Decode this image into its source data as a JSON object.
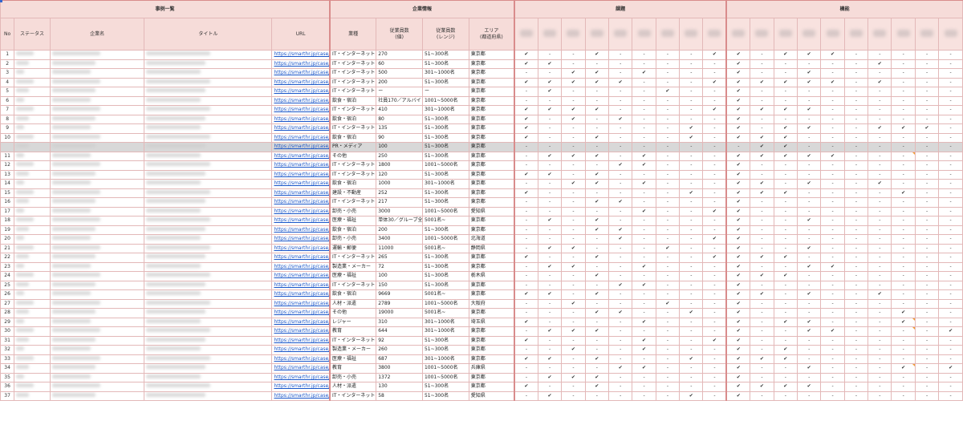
{
  "groups": {
    "cases": "事例一覧",
    "company": "企業情報",
    "issues": "課題",
    "features": "機能"
  },
  "columns": {
    "no": "No",
    "status": "ステータス",
    "company_name": "企業名",
    "title": "タイトル",
    "url": "URL",
    "industry": "業種",
    "employees": "従業員数\n(値)",
    "employees_range": "従業員数\n(レンジ)",
    "area": "エリア\n(都道府県)"
  },
  "rows": [
    {
      "no": "1",
      "url": "https://smarthr.jp/case/25",
      "industry": "IT・インターネット",
      "emp": "270",
      "range": "51~300名",
      "area": "東京都",
      "m": "✔,-,-,✔,-,-,-,-,✔,✔,-,✔,✔,✔,-,-,-,-,-"
    },
    {
      "no": "2",
      "url": "https://smarthr.jp/case/3",
      "industry": "IT・インターネット",
      "emp": "60",
      "range": "51~300名",
      "area": "東京都",
      "m": "✔,✔,-,-,-,-,-,-,-,✔,-,-,-,-,-,✔,-,-,-"
    },
    {
      "no": "3",
      "url": "https://smarthr.jp/case/30",
      "industry": "IT・インターネット",
      "emp": "500",
      "range": "301~1000名",
      "area": "東京都",
      "m": "-,-,✔,✔,-,✔,-,-,-,✔,-,-,✔,-,-,-,-,-,-"
    },
    {
      "no": "4",
      "url": "https://smarthr.jp/case/4",
      "industry": "IT・インターネット",
      "emp": "200",
      "range": "51~300名",
      "area": "東京都",
      "m": "✔,✔,✔,✔,✔,-,-,-,✔,✔,✔,✔,✔,✔,-,✔,-,-,-"
    },
    {
      "no": "5",
      "url": "https://smarthr.jp/case/5",
      "industry": "IT・インターネット",
      "emp": "ー",
      "range": "ー",
      "area": "東京都",
      "m": "-,✔,-,-,-,-,✔,-,-,✔,-,-,-,-,-,-,-,-,-"
    },
    {
      "no": "6",
      "url": "https://smarthr.jp/case/7",
      "industry": "飲食・宿泊",
      "emp": "社員170／アルバイ",
      "range": "1001~5000名",
      "area": "東京都",
      "m": "-,-,-,-,-,-,-,-,-,✔,-,-,-,-,-,-,-,-,-"
    },
    {
      "no": "7",
      "url": "https://smarthr.jp/case/10",
      "industry": "IT・インターネット",
      "emp": "410",
      "range": "301~1000名",
      "area": "東京都",
      "m": "✔,✔,✔,✔,-,-,-,-,✔,✔,✔,✔,✔,-,-,-,-,-,-"
    },
    {
      "no": "8",
      "url": "https://smarthr.jp/case/10",
      "industry": "飲食・宿泊",
      "emp": "80",
      "range": "51~300名",
      "area": "東京都",
      "m": "✔,-,✔,-,✔,-,-,-,-,✔,-,-,-,-,-,-,-,-,-"
    },
    {
      "no": "9",
      "url": "https://smarthr.jp/case/10",
      "industry": "IT・インターネット",
      "emp": "135",
      "range": "51~300名",
      "area": "東京都",
      "m": "✔,-,-,-,-,-,-,✔,-,✔,-,✔,✔,-,-,✔,✔,✔,-"
    },
    {
      "no": "10",
      "url": "https://smarthr.jp/case/10",
      "industry": "飲食・宿泊",
      "emp": "90",
      "range": "51~300名",
      "area": "東京都",
      "m": "✔,-,-,✔,-,-,-,✔,-,✔,✔,✔,-,-,-,-,-,-,-"
    },
    {
      "no": "",
      "url": "https://smarthr.jp/case/11",
      "industry": "PR・メディア",
      "emp": "100",
      "range": "51~300名",
      "area": "東京都",
      "m": "-,-,-,-,-,-,-,-,-,-,✔,✔,-,-,-,-,-,-,-",
      "hl": true
    },
    {
      "no": "11",
      "url": "https://smarthr.jp/case/se",
      "industry": "その他",
      "emp": "250",
      "range": "51~300名",
      "area": "東京都",
      "m": "-,✔,✔,✔,-,✔,-,-,-,✔,✔,✔,✔,✔,-,-,-,-,-"
    },
    {
      "no": "12",
      "url": "https://smarthr.jp/case/dr",
      "industry": "IT・インターネット",
      "emp": "1800",
      "range": "1001~5000名",
      "area": "東京都",
      "m": "-,-,-,-,✔,✔,-,-,-,✔,-,-,-,-,-,-,-,-,-"
    },
    {
      "no": "13",
      "url": "https://smarthr.jp/case/se",
      "industry": "IT・インターネット",
      "emp": "120",
      "range": "51~300名",
      "area": "東京都",
      "m": "✔,✔,-,✔,-,-,-,-,-,✔,-,-,-,-,-,-,-,-,-"
    },
    {
      "no": "14",
      "url": "https://smarthr.jp/case/se",
      "industry": "飲食・宿泊",
      "emp": "1000",
      "range": "301~1000名",
      "area": "東京都",
      "m": "-,-,✔,✔,-,✔,-,-,-,✔,✔,-,✔,-,-,✔,-,-,-"
    },
    {
      "no": "15",
      "url": "https://smarthr.jp/case/ka",
      "industry": "建設・不動産",
      "emp": "252",
      "range": "51~300名",
      "area": "東京都",
      "m": "✔,-,-,-,-,-,-,✔,-,✔,✔,✔,-,-,-,-,✔,-,-"
    },
    {
      "no": "16",
      "url": "https://smarthr.jp/case/ro",
      "industry": "IT・インターネット",
      "emp": "217",
      "range": "51~300名",
      "area": "東京都",
      "m": "-,-,-,✔,✔,-,-,-,-,✔,-,-,-,-,-,-,-,-,-"
    },
    {
      "no": "17",
      "url": "https://smarthr.jp/case/ve",
      "industry": "卸売・小売",
      "emp": "3000",
      "range": "1001~5000名",
      "area": "愛知県",
      "m": "-,-,-,-,-,✔,-,-,✔,✔,-,-,-,-,-,-,-,-,-"
    },
    {
      "no": "18",
      "url": "https://smarthr.jp/case/m",
      "industry": "医療・福祉",
      "emp": "単体30／グループ全",
      "range": "5001名~",
      "area": "東京都",
      "m": "-,✔,-,✔,-,-,-,-,-,✔,-,-,✔,-,-,-,-,-,-"
    },
    {
      "no": "19",
      "url": "https://smarthr.jp/case/sa",
      "industry": "飲食・宿泊",
      "emp": "200",
      "range": "51~300名",
      "area": "東京都",
      "m": "-,-,-,✔,✔,-,-,-,-,✔,-,-,-,-,-,-,-,-,-"
    },
    {
      "no": "20",
      "url": "https://smarthr.jp/case/sa",
      "industry": "卸売・小売",
      "emp": "3400",
      "range": "1001~5000名",
      "area": "北海道",
      "m": "-,-,-,-,✔,-,-,-,✔,✔,-,-,-,-,-,-,-,-,-"
    },
    {
      "no": "21",
      "url": "https://smarthr.jp/case/sa",
      "industry": "運輸・郵便",
      "emp": "11000",
      "range": "5001名~",
      "area": "静岡県",
      "m": "-,✔,✔,-,-,-,✔,-,-,✔,-,-,✔,-,-,-,-,-,-"
    },
    {
      "no": "22",
      "url": "https://smarthr.jp/case/cl",
      "industry": "IT・インターネット",
      "emp": "265",
      "range": "51~300名",
      "area": "東京都",
      "m": "✔,-,-,✔,-,-,-,-,✔,✔,✔,✔,-,-,-,-,-,-,-"
    },
    {
      "no": "23",
      "url": "https://smarthr.jp/case/la",
      "industry": "製造業・メーカー",
      "emp": "72",
      "range": "51~300名",
      "area": "東京都",
      "m": "-,✔,✔,-,-,✔,-,-,-,✔,-,-,✔,✔,-,-,-,-,-"
    },
    {
      "no": "24",
      "url": "https://smarthr.jp/case/id",
      "industry": "医療・福祉",
      "emp": "100",
      "range": "51~300名",
      "area": "栃木県",
      "m": "-,-,-,✔,-,-,-,-,-,✔,✔,✔,-,-,-,-,-,-,-"
    },
    {
      "no": "25",
      "url": "https://smarthr.jp/case/se",
      "industry": "IT・インターネット",
      "emp": "150",
      "range": "51~300名",
      "area": "東京都",
      "m": "-,-,-,-,✔,✔,-,-,-,✔,-,-,-,-,-,-,-,-,-"
    },
    {
      "no": "26",
      "url": "https://smarthr.jp/case/sh",
      "industry": "飲食・宿泊",
      "emp": "9669",
      "range": "5001名~",
      "area": "東京都",
      "m": "✔,✔,-,✔,-,-,-,-,-,✔,✔,-,✔,-,-,✔,-,-,-"
    },
    {
      "no": "27",
      "url": "https://smarthr.jp/case/dh",
      "industry": "人材・派遣",
      "emp": "2789",
      "range": "1001~5000名",
      "area": "大阪府",
      "m": "-,-,✔,-,-,-,✔,-,-,✔,-,-,-,-,-,-,-,-,-"
    },
    {
      "no": "28",
      "url": "https://smarthr.jp/case/he",
      "industry": "その他",
      "emp": "19000",
      "range": "5001名~",
      "area": "東京都",
      "m": "-,-,-,✔,✔,-,-,✔,-,✔,-,-,-,-,-,-,✔,-,-"
    },
    {
      "no": "29",
      "url": "https://smarthr.jp/case/to",
      "industry": "レジャー",
      "emp": "310",
      "range": "301~1000名",
      "area": "埼玉県",
      "m": "✔,-,-,-,-,✔,-,-,-,✔,-,✔,✔,-,-,-,✔,-,-"
    },
    {
      "no": "30",
      "url": "https://smarthr.jp/case/ty",
      "industry": "教育",
      "emp": "644",
      "range": "301~1000名",
      "area": "東京都",
      "m": "-,✔,✔,✔,-,-,-,-,-,✔,-,-,✔,✔,-,-,-,-,✔"
    },
    {
      "no": "31",
      "url": "https://smarthr.jp/case/ak",
      "industry": "IT・インターネット",
      "emp": "92",
      "range": "51~300名",
      "area": "東京都",
      "m": "✔,-,-,-,-,✔,-,-,✔,✔,-,-,-,-,-,-,-,-,-"
    },
    {
      "no": "32",
      "url": "https://smarthr.jp/case/ka",
      "industry": "製造業・メーカー",
      "emp": "260",
      "range": "51~300名",
      "area": "東京都",
      "m": "-,-,✔,-,-,✔,-,-,-,✔,-,✔,-,-,-,-,-,-,-"
    },
    {
      "no": "33",
      "url": "https://smarthr.jp/case/fu",
      "industry": "医療・福祉",
      "emp": "687",
      "range": "301~1000名",
      "area": "東京都",
      "m": "✔,✔,-,✔,-,-,-,✔,-,✔,✔,✔,-,-,-,-,-,-,-"
    },
    {
      "no": "34",
      "url": "https://smarthr.jp/case/ka",
      "industry": "教育",
      "emp": "3800",
      "range": "1001~5000名",
      "area": "兵庫県",
      "m": "-,-,-,-,✔,✔,-,-,-,✔,-,-,✔,-,-,-,✔,-,✔"
    },
    {
      "no": "35",
      "url": "https://smarthr.jp/case/fu",
      "industry": "卸売・小売",
      "emp": "1372",
      "range": "1001~5000名",
      "area": "東京都",
      "m": "-,✔,✔,✔,-,-,-,-,-,✔,-,-,-,-,-,-,-,-,-"
    },
    {
      "no": "36",
      "url": "https://smarthr.jp/case/sa",
      "industry": "人材・派遣",
      "emp": "130",
      "range": "51~300名",
      "area": "東京都",
      "m": "✔,-,-,✔,-,-,-,-,-,✔,✔,✔,✔,-,-,-,-,-,-"
    },
    {
      "no": "37",
      "url": "https://smarthr.jp/case/st",
      "industry": "IT・インターネット",
      "emp": "58",
      "range": "51~300名",
      "area": "愛知県",
      "m": "-,✔,-,-,-,-,-,✔,-,✔,-,-,-,-,-,-,-,-,-"
    }
  ]
}
